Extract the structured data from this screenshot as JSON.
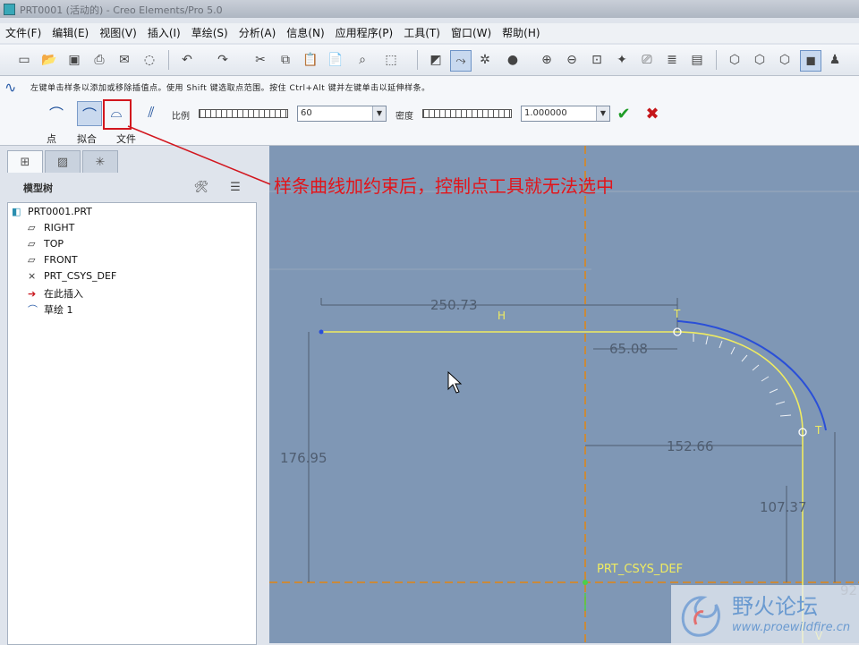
{
  "window": {
    "title": "PRT0001 (活动的) - Creo Elements/Pro 5.0"
  },
  "menu": [
    "文件(F)",
    "编辑(E)",
    "视图(V)",
    "插入(I)",
    "草绘(S)",
    "分析(A)",
    "信息(N)",
    "应用程序(P)",
    "工具(T)",
    "窗口(W)",
    "帮助(H)"
  ],
  "toolbar": {
    "icons": [
      "new-file-icon",
      "open-icon",
      "save-icon",
      "print-icon",
      "send-icon",
      "close-window-icon",
      "undo-icon",
      "redo-icon",
      "cut-icon",
      "copy-icon",
      "paste-icon",
      "paste-special-icon",
      "find-icon",
      "select-box-icon",
      "sketch-mode-icon",
      "spline-icon",
      "regenerate-icon",
      "shading-icon",
      "zoom-in-icon",
      "zoom-out-icon",
      "refit-icon",
      "reorient-icon",
      "saved-views-icon",
      "layers-icon",
      "view-manager-icon",
      "wireframe-icon",
      "hidden-line-icon",
      "no-hidden-icon",
      "shaded-icon",
      "model-tree-icon"
    ]
  },
  "dashboard": {
    "message": "左键单击样条以添加或移除插值点。使用 Shift 键选取点范围。按住 Ctrl+Alt 键并左键单击以延伸样条。",
    "mode_labels": {
      "point": "点",
      "fit": "拟合",
      "file": "文件"
    },
    "scale_label": "比例",
    "scale_value": "60",
    "density_label": "密度",
    "density_value": "1.000000"
  },
  "annotation": "样条曲线加约束后，控制点工具就无法选中",
  "model_tree": {
    "header": "模型树",
    "items": [
      {
        "label": "PRT0001.PRT",
        "icon": "part-icon"
      },
      {
        "label": "RIGHT",
        "icon": "datum-plane-icon"
      },
      {
        "label": "TOP",
        "icon": "datum-plane-icon"
      },
      {
        "label": "FRONT",
        "icon": "datum-plane-icon"
      },
      {
        "label": "PRT_CSYS_DEF",
        "icon": "csys-icon"
      },
      {
        "label": "在此插入",
        "icon": "insert-arrow-icon"
      },
      {
        "label": "草绘 1",
        "icon": "sketch-icon"
      }
    ]
  },
  "sketch": {
    "dimensions": {
      "d1": "250.73",
      "d2": "65.08",
      "d3": "176.95",
      "d4": "152.66",
      "d5": "107.37",
      "d6": "92"
    },
    "labels": {
      "h": "H",
      "v": "V",
      "t1": "T",
      "t2": "T",
      "csys": "PRT_CSYS_DEF"
    }
  },
  "watermark": {
    "title": "野火论坛",
    "url": "www.proewildfire.cn"
  },
  "colors": {
    "viewport": "#7f97b5",
    "accent_red": "#d2161e",
    "spline_blue": "#2a4fd8",
    "sketch_yellow": "#f0ec60"
  }
}
